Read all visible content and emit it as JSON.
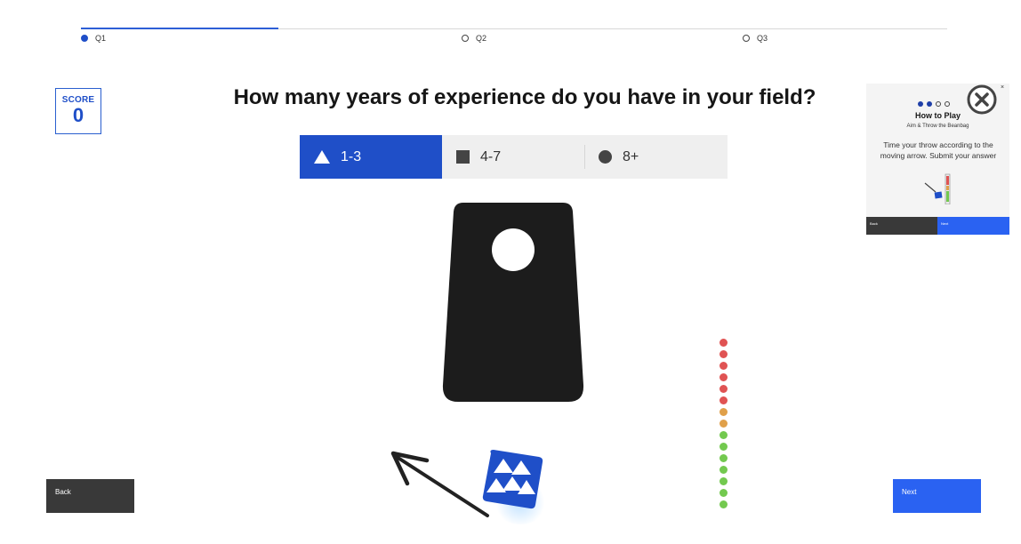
{
  "progress": {
    "fraction": 0.228,
    "steps": [
      {
        "label": "Q1",
        "active": true
      },
      {
        "label": "Q2",
        "active": false
      },
      {
        "label": "Q3",
        "active": false
      }
    ]
  },
  "score": {
    "label": "SCORE",
    "value": "0"
  },
  "question": "How many years of experience do you have in your field?",
  "answers": [
    {
      "label": "1-3",
      "shape": "triangle-icon",
      "selected": true
    },
    {
      "label": "4-7",
      "shape": "square-icon",
      "selected": false
    },
    {
      "label": "8+",
      "shape": "circle-icon",
      "selected": false
    }
  ],
  "power_meter": {
    "colors": [
      "#e05353",
      "#e05353",
      "#e05353",
      "#e05353",
      "#e05353",
      "#e05353",
      "#e0a04a",
      "#e0a04a",
      "#73c94f",
      "#73c94f",
      "#73c94f",
      "#73c94f",
      "#73c94f",
      "#73c94f",
      "#73c94f"
    ]
  },
  "nav": {
    "back_label": "Back",
    "next_label": "Next"
  },
  "how_to_play": {
    "title": "How to Play",
    "subtitle": "Aim & Throw the Beanbag",
    "description": "Time your throw according to the moving arrow.  Submit your answer",
    "close_glyph": "×",
    "back_label": "Back",
    "next_label": "Next"
  },
  "colors": {
    "accent": "#1f4fc8",
    "next_button": "#2a62f2",
    "back_button": "#393939",
    "board": "#1c1c1c"
  }
}
